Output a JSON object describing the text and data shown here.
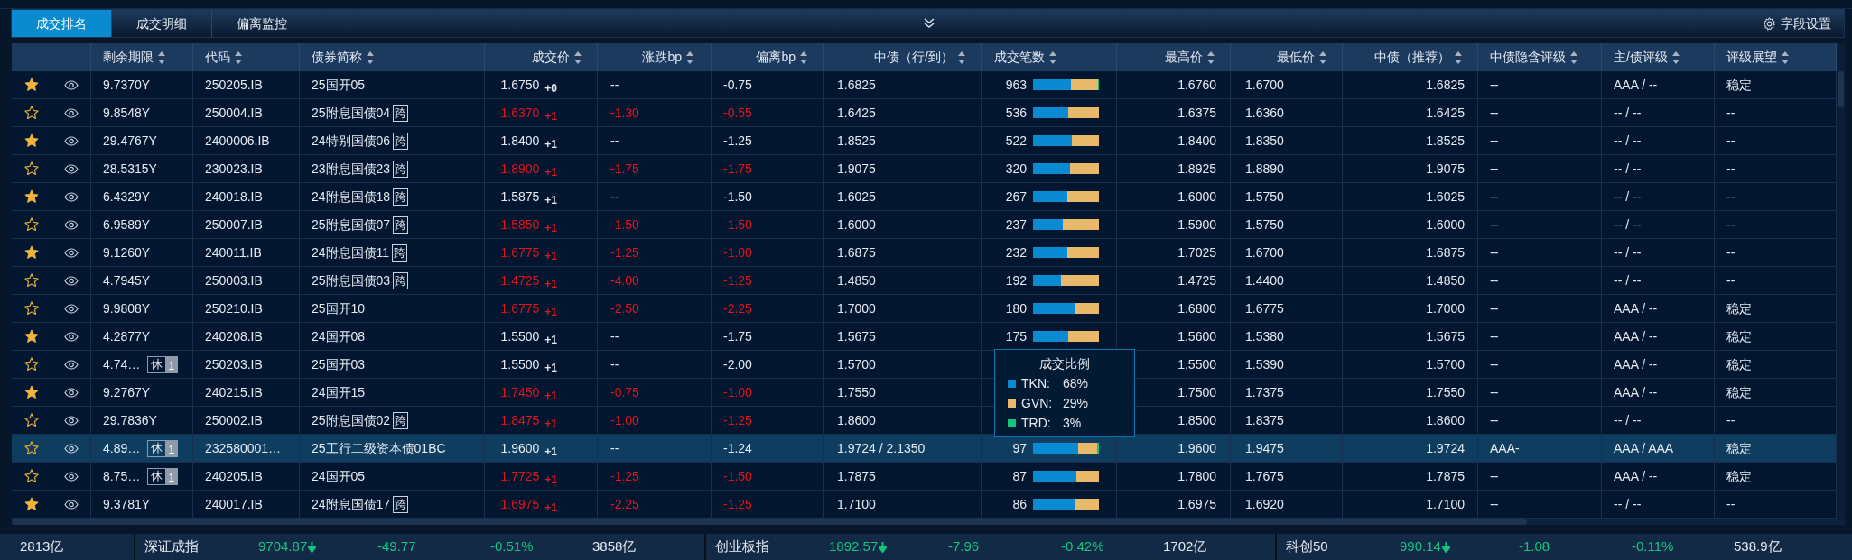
{
  "tabs": [
    {
      "label": "成交排名",
      "selected": true
    },
    {
      "label": "成交明细",
      "selected": false
    },
    {
      "label": "偏离监控",
      "selected": false
    }
  ],
  "toolbar": {
    "settings_label": "字段设置"
  },
  "table": {
    "columns": [
      "剩余期限",
      "代码",
      "债券简称",
      "成交价",
      "涨跌bp",
      "偏离bp",
      "中债（行/到）",
      "成交笔数",
      "最高价",
      "最低价",
      "中债（推荐）",
      "中债隐含评级",
      "主/债评级",
      "评级展望"
    ],
    "rows": [
      {
        "starred": true,
        "selected": false,
        "alert": false,
        "term": "9.7370Y",
        "code": "250205.IB",
        "name": "25国开05",
        "price": "1.6750",
        "price_change": "+0",
        "change_bp": "--",
        "deviation_bp": "-0.75",
        "cbond_value": "1.6825",
        "trade_count": "963",
        "volume_bar": [
          {
            "color": "#0a8ad0",
            "level": 0.57
          },
          {
            "color": "#e8b96a",
            "level": 0.42
          },
          {
            "color": "#10c680",
            "level": 0.01
          }
        ],
        "high": "1.6760",
        "low": "1.6700",
        "cbond_recommended": "1.6825",
        "implied_rating": "--",
        "rating": "AAA / --",
        "outlook": "稳定"
      },
      {
        "starred": false,
        "selected": false,
        "alert": true,
        "term": "9.8548Y",
        "code": "250004.IB",
        "name": "25附息国债04",
        "cross_badge": "跨",
        "price": "1.6370",
        "price_change": "+1",
        "change_bp": "-1.30",
        "deviation_bp": "-0.55",
        "cbond_value": "1.6425",
        "trade_count": "536",
        "volume_bar": [
          {
            "color": "#0a8ad0",
            "level": 0.53
          },
          {
            "color": "#e8b96a",
            "level": 0.47
          }
        ],
        "high": "1.6375",
        "low": "1.6360",
        "cbond_recommended": "1.6425",
        "implied_rating": "--",
        "rating": "-- / --",
        "outlook": "--"
      },
      {
        "starred": true,
        "selected": false,
        "alert": false,
        "term": "29.4767Y",
        "code": "2400006.IB",
        "name": "24特别国债06",
        "cross_badge": "跨",
        "price": "1.8400",
        "price_change": "+1",
        "change_bp": "--",
        "deviation_bp": "-1.25",
        "cbond_value": "1.8525",
        "trade_count": "522",
        "volume_bar": [
          {
            "color": "#0a8ad0",
            "level": 0.59
          },
          {
            "color": "#e8b96a",
            "level": 0.41
          }
        ],
        "high": "1.8400",
        "low": "1.8350",
        "cbond_recommended": "1.8525",
        "implied_rating": "--",
        "rating": "-- / --",
        "outlook": "--"
      },
      {
        "starred": false,
        "selected": false,
        "alert": true,
        "term": "28.5315Y",
        "code": "230023.IB",
        "name": "23附息国债23",
        "cross_badge": "跨",
        "price": "1.8900",
        "price_change": "+1",
        "change_bp": "-1.75",
        "deviation_bp": "-1.75",
        "cbond_value": "1.9075",
        "trade_count": "320",
        "volume_bar": [
          {
            "color": "#0a8ad0",
            "level": 0.56
          },
          {
            "color": "#e8b96a",
            "level": 0.44
          }
        ],
        "high": "1.8925",
        "low": "1.8890",
        "cbond_recommended": "1.9075",
        "implied_rating": "--",
        "rating": "-- / --",
        "outlook": "--"
      },
      {
        "starred": true,
        "selected": false,
        "alert": false,
        "term": "6.4329Y",
        "code": "240018.IB",
        "name": "24附息国债18",
        "cross_badge": "跨",
        "price": "1.5875",
        "price_change": "+1",
        "change_bp": "--",
        "deviation_bp": "-1.50",
        "cbond_value": "1.6025",
        "trade_count": "267",
        "volume_bar": [
          {
            "color": "#0a8ad0",
            "level": 0.52
          },
          {
            "color": "#e8b96a",
            "level": 0.48
          }
        ],
        "high": "1.6000",
        "low": "1.5750",
        "cbond_recommended": "1.6025",
        "implied_rating": "--",
        "rating": "-- / --",
        "outlook": "--"
      },
      {
        "starred": false,
        "selected": false,
        "alert": true,
        "term": "6.9589Y",
        "code": "250007.IB",
        "name": "25附息国债07",
        "cross_badge": "跨",
        "price": "1.5850",
        "price_change": "+1",
        "change_bp": "-1.50",
        "deviation_bp": "-1.50",
        "cbond_value": "1.6000",
        "trade_count": "237",
        "volume_bar": [
          {
            "color": "#0a8ad0",
            "level": 0.45
          },
          {
            "color": "#e8b96a",
            "level": 0.55
          }
        ],
        "high": "1.5900",
        "low": "1.5750",
        "cbond_recommended": "1.6000",
        "implied_rating": "--",
        "rating": "-- / --",
        "outlook": "--"
      },
      {
        "starred": true,
        "selected": false,
        "alert": true,
        "term": "9.1260Y",
        "code": "240011.IB",
        "name": "24附息国债11",
        "cross_badge": "跨",
        "price": "1.6775",
        "price_change": "+1",
        "change_bp": "-1.25",
        "deviation_bp": "-1.00",
        "cbond_value": "1.6875",
        "trade_count": "232",
        "volume_bar": [
          {
            "color": "#0a8ad0",
            "level": 0.52
          },
          {
            "color": "#e8b96a",
            "level": 0.48
          }
        ],
        "high": "1.7025",
        "low": "1.6700",
        "cbond_recommended": "1.6875",
        "implied_rating": "--",
        "rating": "-- / --",
        "outlook": "--"
      },
      {
        "starred": false,
        "selected": false,
        "alert": true,
        "term": "4.7945Y",
        "code": "250003.IB",
        "name": "25附息国债03",
        "cross_badge": "跨",
        "price": "1.4725",
        "price_change": "+1",
        "change_bp": "-4.00",
        "deviation_bp": "-1.25",
        "cbond_value": "1.4850",
        "trade_count": "192",
        "volume_bar": [
          {
            "color": "#0a8ad0",
            "level": 0.43
          },
          {
            "color": "#e8b96a",
            "level": 0.57
          }
        ],
        "high": "1.4725",
        "low": "1.4400",
        "cbond_recommended": "1.4850",
        "implied_rating": "--",
        "rating": "-- / --",
        "outlook": "--"
      },
      {
        "starred": false,
        "selected": false,
        "alert": true,
        "term": "9.9808Y",
        "code": "250210.IB",
        "name": "25国开10",
        "price": "1.6775",
        "price_change": "+1",
        "change_bp": "-2.50",
        "deviation_bp": "-2.25",
        "cbond_value": "1.7000",
        "trade_count": "180",
        "volume_bar": [
          {
            "color": "#0a8ad0",
            "level": 0.64
          },
          {
            "color": "#e8b96a",
            "level": 0.36
          }
        ],
        "high": "1.6800",
        "low": "1.6775",
        "cbond_recommended": "1.7000",
        "implied_rating": "--",
        "rating": "AAA / --",
        "outlook": "稳定"
      },
      {
        "starred": true,
        "selected": false,
        "alert": false,
        "term": "4.2877Y",
        "code": "240208.IB",
        "name": "24国开08",
        "price": "1.5500",
        "price_change": "+1",
        "change_bp": "--",
        "deviation_bp": "-1.75",
        "cbond_value": "1.5675",
        "trade_count": "175",
        "volume_bar": [
          {
            "color": "#0a8ad0",
            "level": 0.53
          },
          {
            "color": "#e8b96a",
            "level": 0.47
          }
        ],
        "high": "1.5600",
        "low": "1.5380",
        "cbond_recommended": "1.5675",
        "implied_rating": "--",
        "rating": "AAA / --",
        "outlook": "稳定"
      },
      {
        "starred": false,
        "selected": false,
        "alert": false,
        "term": "4.74…",
        "rest_badge": {
          "label": "休",
          "count": "1"
        },
        "code": "250203.IB",
        "name": "25国开03",
        "price": "1.5500",
        "price_change": "+1",
        "change_bp": "--",
        "deviation_bp": "-2.00",
        "cbond_value": "1.5700",
        "high": "1.5500",
        "low": "1.5390",
        "cbond_recommended": "1.5700",
        "implied_rating": "--",
        "rating": "AAA / --",
        "outlook": "稳定"
      },
      {
        "starred": true,
        "selected": false,
        "alert": true,
        "term": "9.2767Y",
        "code": "240215.IB",
        "name": "24国开15",
        "price": "1.7450",
        "price_change": "+1",
        "change_bp": "-0.75",
        "deviation_bp": "-1.00",
        "cbond_value": "1.7550",
        "high": "1.7500",
        "low": "1.7375",
        "cbond_recommended": "1.7550",
        "implied_rating": "--",
        "rating": "AAA / --",
        "outlook": "稳定"
      },
      {
        "starred": false,
        "selected": false,
        "alert": true,
        "term": "29.7836Y",
        "code": "250002.IB",
        "name": "25附息国债02",
        "cross_badge": "跨",
        "price": "1.8475",
        "price_change": "+1",
        "change_bp": "-1.00",
        "deviation_bp": "-1.25",
        "cbond_value": "1.8600",
        "high": "1.8500",
        "low": "1.8375",
        "cbond_recommended": "1.8600",
        "implied_rating": "--",
        "rating": "-- / --",
        "outlook": "--"
      },
      {
        "starred": false,
        "selected": true,
        "alert": false,
        "term": "4.89…",
        "rest_badge": {
          "label": "休",
          "count": "1"
        },
        "code": "232580001…",
        "name": "25工行二级资本债01BC",
        "price": "1.9600",
        "price_change": "+1",
        "change_bp": "--",
        "deviation_bp": "-1.24",
        "cbond_value": "1.9724 / 2.1350",
        "trade_count": "97",
        "volume_bar": [
          {
            "color": "#0a8ad0",
            "level": 0.68
          },
          {
            "color": "#e8b96a",
            "level": 0.29
          },
          {
            "color": "#10c680",
            "level": 0.03
          }
        ],
        "high": "1.9600",
        "low": "1.9475",
        "cbond_recommended": "1.9724",
        "implied_rating": "AAA-",
        "rating": "AAA / AAA",
        "outlook": "稳定"
      },
      {
        "starred": false,
        "selected": false,
        "alert": true,
        "term": "8.75…",
        "rest_badge": {
          "label": "休",
          "count": "1"
        },
        "code": "240205.IB",
        "name": "24国开05",
        "price": "1.7725",
        "price_change": "+1",
        "change_bp": "-1.25",
        "deviation_bp": "-1.50",
        "cbond_value": "1.7875",
        "trade_count": "87",
        "volume_bar": [
          {
            "color": "#0a8ad0",
            "level": 0.66
          },
          {
            "color": "#e8b96a",
            "level": 0.34
          }
        ],
        "high": "1.7800",
        "low": "1.7675",
        "cbond_recommended": "1.7875",
        "implied_rating": "--",
        "rating": "AAA / --",
        "outlook": "稳定"
      },
      {
        "starred": true,
        "selected": false,
        "alert": true,
        "term": "9.3781Y",
        "code": "240017.IB",
        "name": "24附息国债17",
        "cross_badge": "跨",
        "price": "1.6975",
        "price_change": "+1",
        "change_bp": "-2.25",
        "deviation_bp": "-1.25",
        "cbond_value": "1.7100",
        "trade_count": "86",
        "volume_bar": [
          {
            "color": "#0a8ad0",
            "level": 0.64
          },
          {
            "color": "#e8b96a",
            "level": 0.36
          }
        ],
        "high": "1.6975",
        "low": "1.6920",
        "cbond_recommended": "1.7100",
        "implied_rating": "--",
        "rating": "-- / --",
        "outlook": "--"
      }
    ]
  },
  "tooltip": {
    "title": "成交比例",
    "items": [
      {
        "label": "TKN:",
        "value": "68%",
        "color": "#0a8ad0"
      },
      {
        "label": "GVN:",
        "value": "29%",
        "color": "#e8b96a"
      },
      {
        "label": "TRD:",
        "value": "3%",
        "color": "#10c680"
      }
    ]
  },
  "ticker": {
    "lead": "2813亿",
    "indices": [
      {
        "name": "深证成指",
        "price": "9704.87",
        "falling": true,
        "change": "-49.77",
        "percent": "-0.51%",
        "volume": "3858亿"
      },
      {
        "name": "创业板指",
        "price": "1892.57",
        "falling": true,
        "change": "-7.96",
        "percent": "-0.42%",
        "volume": "1702亿"
      },
      {
        "name": "科创50",
        "price": "990.14",
        "falling": true,
        "change": "-1.08",
        "percent": "-0.11%",
        "volume": "538.9亿"
      }
    ]
  }
}
